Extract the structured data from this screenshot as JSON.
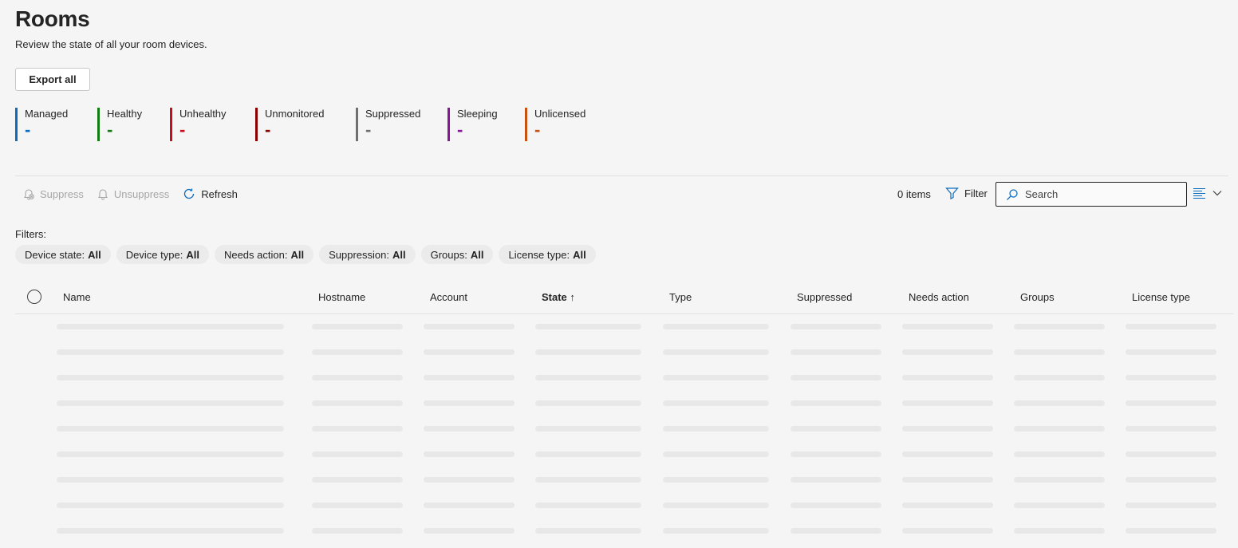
{
  "header": {
    "title": "Rooms",
    "subtitle": "Review the state of all your room devices.",
    "export_label": "Export all"
  },
  "stats": [
    {
      "label": "Managed",
      "value": "-",
      "color": "#0f6cbd"
    },
    {
      "label": "Healthy",
      "value": "-",
      "color": "#107c10"
    },
    {
      "label": "Unhealthy",
      "value": "-",
      "color": "#c50f1f"
    },
    {
      "label": "Unmonitored",
      "value": "-",
      "color": "#8b0000"
    },
    {
      "label": "Suppressed",
      "value": "-",
      "color": "#707070"
    },
    {
      "label": "Sleeping",
      "value": "-",
      "color": "#881798"
    },
    {
      "label": "Unlicensed",
      "value": "-",
      "color": "#ca5010"
    }
  ],
  "toolbar": {
    "suppress_label": "Suppress",
    "unsuppress_label": "Unsuppress",
    "refresh_label": "Refresh",
    "items_count": "0 items",
    "filter_label": "Filter",
    "search_placeholder": "Search"
  },
  "filters": {
    "label": "Filters:",
    "chips": [
      {
        "name": "Device state:",
        "value": "All"
      },
      {
        "name": "Device type:",
        "value": "All"
      },
      {
        "name": "Needs action:",
        "value": "All"
      },
      {
        "name": "Suppression:",
        "value": "All"
      },
      {
        "name": "Groups:",
        "value": "All"
      },
      {
        "name": "License type:",
        "value": "All"
      }
    ]
  },
  "table": {
    "columns": [
      "Name",
      "Hostname",
      "Account",
      "State",
      "Type",
      "Suppressed",
      "Needs action",
      "Groups",
      "License type"
    ],
    "sorted_column": "State",
    "sort_indicator": "↑",
    "placeholder_row_count": 9
  }
}
